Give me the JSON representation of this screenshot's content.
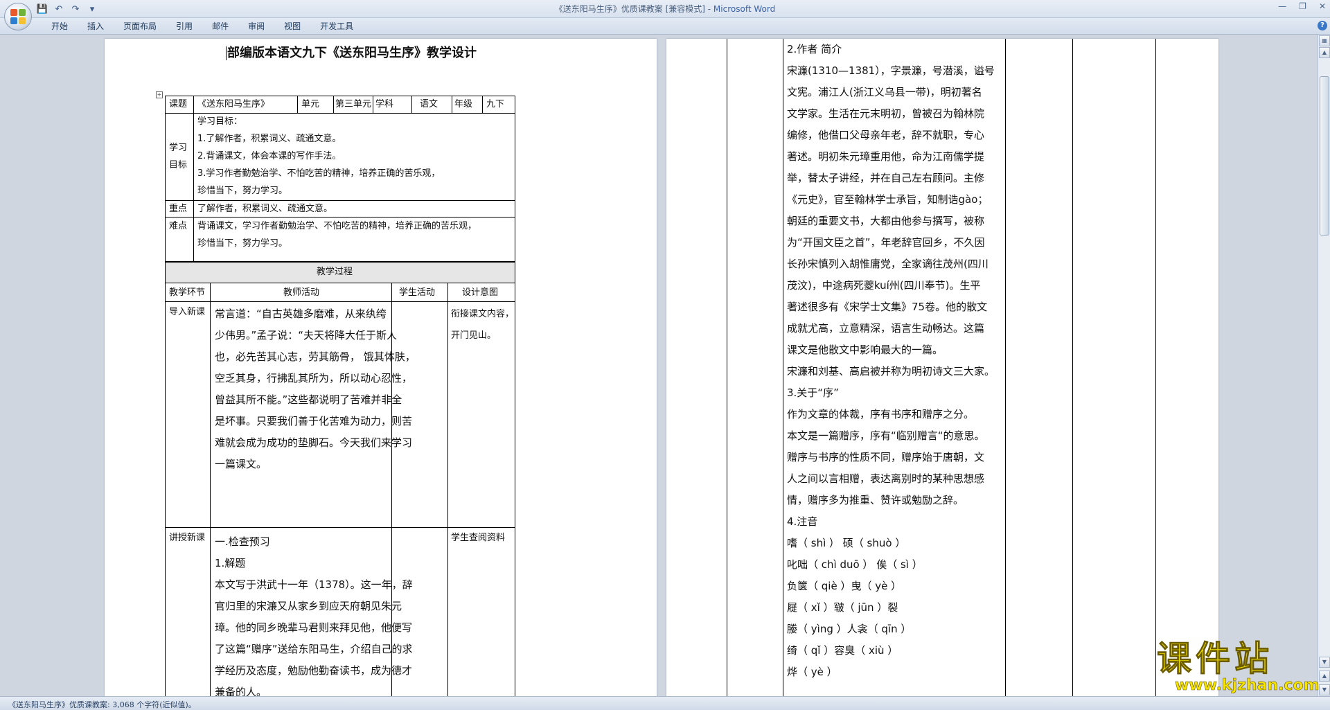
{
  "window": {
    "title": "《送东阳马生序》优质课教案 [兼容模式] - ",
    "app_name": "Microsoft Word"
  },
  "ribbon": {
    "tabs": [
      "开始",
      "插入",
      "页面布局",
      "引用",
      "邮件",
      "审阅",
      "视图",
      "开发工具"
    ]
  },
  "page1": {
    "doc_title": "部编版本语文九下《送东阳马生序》教学设计",
    "info_row": {
      "label_topic": "课题",
      "topic": "《送东阳马生序》",
      "label_unit": "单元",
      "unit": "第三单元",
      "label_subject": "学科",
      "subject": "语文",
      "label_grade": "年级",
      "grade": "九下"
    },
    "goals": {
      "label_1": "学习",
      "label_2": "目标",
      "lines": [
        "学习目标：",
        "1.了解作者，积累词义、疏通文意。",
        "2.背诵课文，体会本课的写作手法。",
        "3.学习作者勤勉治学、不怕吃苦的精神，培养正确的苦乐观，",
        " 珍惜当下，努力学习。"
      ]
    },
    "key_point": {
      "label": "重点",
      "text": "了解作者，积累词义、疏通文意。"
    },
    "difficulty": {
      "label": "难点",
      "lines": [
        "背诵课文，学习作者勤勉治学、不怕吃苦的精神，培养正确的苦乐观，",
        " 珍惜当下，努力学习。"
      ]
    },
    "process_header": "教学过程",
    "columns": [
      "教学环节",
      "教师活动",
      "学生活动",
      "设计意图"
    ],
    "intro": {
      "stage": "导入新课",
      "teacher": [
        "   常言道：“自古英雄多磨难，从来纨绔",
        "少伟男。”孟子说：“夫天将降大任于斯人",
        "也，必先苦其心志，劳其筋骨，  饿其体肤，",
        "空乏其身，行拂乱其所为，所以动心忍性，",
        "曾益其所不能。”这些都说明了苦难并非全",
        "是坏事。只要我们善于化苦难为动力，则苦",
        "难就会成为成功的垫脚石。今天我们来学习",
        "一篇课文。"
      ],
      "intent": [
        "  衔接课文内容，",
        "开门见山。"
      ]
    },
    "lecture": {
      "stage": "讲授新课",
      "teacher": [
        "   一.检查预习",
        "1.解题",
        "本文写于洪武十一年（1378）。这一年，辞",
        "官归里的宋濂又从家乡到应天府朝见朱元",
        "璋。他的同乡晚辈马君则来拜见他，他便写",
        "了这篇“赠序”送给东阳马生，介绍自己的求",
        "学经历及态度，勉励他勤奋读书，成为德才",
        "兼备的人。"
      ],
      "intent": [
        "学生查阅资料"
      ]
    }
  },
  "page2": {
    "lines": [
      "2.作者 简介",
      "宋濂(1310—1381），字景濂，号潜溪，谥号",
      "文宪。浦江人(浙江义乌县一带)，明初著名",
      "文学家。生活在元末明初，曾被召为翰林院",
      "编修，他借口父母亲年老，辞不就职，专心",
      "著述。明初朱元璋重用他，命为江南儒学提",
      "举，替太子讲经，并在自己左右顾问。主修",
      "《元史》，官至翰林学士承旨，知制诰gào；",
      "朝廷的重要文书，大都由他参与撰写，被称",
      "为“开国文臣之首”，年老辞官回乡，不久因",
      "长孙宋慎列入胡惟庸党，全家谪往茂州(四川",
      "茂汶)，中途病死夔kuí州(四川奉节)。生平",
      "著述很多有《宋学士文集》75卷。他的散文",
      "成就尤高，立意精深，语言生动畅达。这篇",
      "课文是他散文中影响最大的一篇。",
      "宋濂和刘基、高启被并称为明初诗文三大家。",
      "3.关于“序”",
      "作为文章的体裁，序有书序和赠序之分。",
      "本文是一篇赠序，序有“临别赠言“的意思。",
      "赠序与书序的性质不同，赠序始于唐朝，文",
      "人之间以言相赠，表达离别时的某种思想感",
      "情，赠序多为推重、赞许或勉励之辞。",
      "4.注音",
      "嗜（    shì ）         硕（    shuò ）",
      "叱咄（   chì duō ）   俟（   sì  ）",
      "负箧（  qiè ）曳（   yè  ）",
      "屣（   xǐ  ）皲（ jūn ）裂",
      " 媵（      yìng ）人衾（    qīn   ）",
      "绮（    qǐ ）容臭（   xiù ）",
      " 烨（     yè ）"
    ]
  },
  "status": {
    "text": "《送东阳马生序》优质课教案: 3,068 个字符(近似值)。"
  },
  "watermark": {
    "cn": "课件站",
    "url": "www.kjzhan.com"
  }
}
